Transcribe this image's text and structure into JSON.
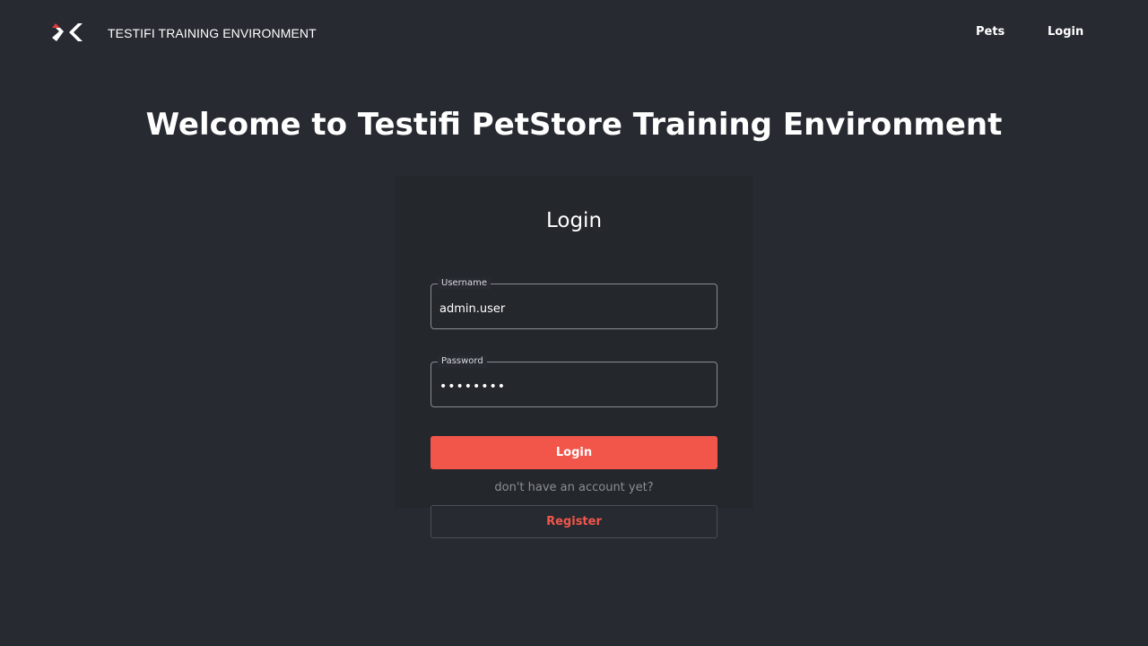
{
  "header": {
    "logo_icon": "testifi-logo-icon",
    "brand": "TESTIFI TRAINING ENVIRONMENT",
    "nav": {
      "pets": "Pets",
      "login": "Login"
    }
  },
  "main": {
    "welcome": "Welcome to Testifi PetStore Training Environment",
    "form": {
      "title": "Login",
      "username": {
        "label": "Username",
        "value": "admin.user"
      },
      "password": {
        "label": "Password",
        "value": "••••••••"
      },
      "login_button": "Login",
      "no_account_text": "don't have an account yet?",
      "register_button": "Register"
    }
  },
  "colors": {
    "background": "#272a31",
    "accent": "#f2564b",
    "logo_red": "#e0393b",
    "muted_text": "#8b8e94"
  }
}
